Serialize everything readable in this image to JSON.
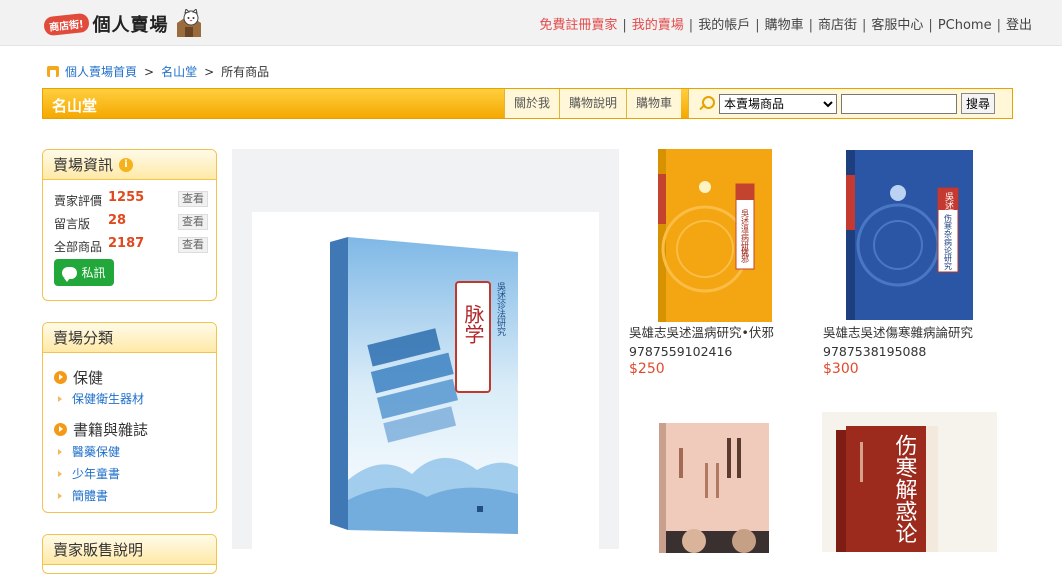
{
  "header": {
    "logo_badge": "商店街!",
    "logo_text": "個人賣場",
    "nav": [
      {
        "label": "免費註冊賣家",
        "highlight": true
      },
      {
        "label": "我的賣場",
        "highlight": true
      },
      {
        "label": "我的帳戶",
        "highlight": false
      },
      {
        "label": "購物車",
        "highlight": false
      },
      {
        "label": "商店街",
        "highlight": false
      },
      {
        "label": "客服中心",
        "highlight": false
      },
      {
        "label": "PChome",
        "highlight": false
      },
      {
        "label": "登出",
        "highlight": false
      }
    ]
  },
  "breadcrumb": {
    "home": "個人賣場首頁",
    "store": "名山堂",
    "current": "所有商品",
    "separator": ">"
  },
  "storebar": {
    "name": "名山堂",
    "tabs": [
      "關於我",
      "購物說明",
      "購物車"
    ],
    "scope_selected": "本賣場商品",
    "search_button": "搜尋"
  },
  "info_box": {
    "title": "賣場資訊",
    "info_icon": "i",
    "rows": [
      {
        "label": "賣家評價",
        "value": "1255",
        "action": "查看"
      },
      {
        "label": "留言版",
        "value": "28",
        "action": "查看"
      },
      {
        "label": "全部商品",
        "value": "2187",
        "action": "查看"
      }
    ],
    "message_button": "私訊"
  },
  "category_box": {
    "title": "賣場分類",
    "groups": [
      {
        "name": "保健",
        "items": [
          "保健衛生器材"
        ]
      },
      {
        "name": "書籍與雜誌",
        "items": [
          "醫藥保健",
          "少年童書",
          "簡體書"
        ]
      }
    ]
  },
  "third_box": {
    "title": "賣家販售說明"
  },
  "products": [
    {
      "name": "吳雄志吳述溫病研究•伏邪9787559102416",
      "price": "$250"
    },
    {
      "name": "吳雄志吳述傷寒雜病論研究9787538195088",
      "price": "$300"
    }
  ],
  "book_text": {
    "featured_title": "脉学",
    "featured_series": "吳述诊法研究",
    "yellow_series": "吳述溫病研究",
    "yellow_subtitle": "伏邪",
    "blue_series": "吳述",
    "blue_subtitle": "伤寒杂病论研究",
    "red_title": "伤寒解惑论"
  },
  "colors": {
    "accent_orange": "#f5a800",
    "link_blue": "#1f6fc9",
    "price_red": "#e04a2d",
    "highlight_red": "#e24a4a",
    "message_green": "#22a83a"
  }
}
